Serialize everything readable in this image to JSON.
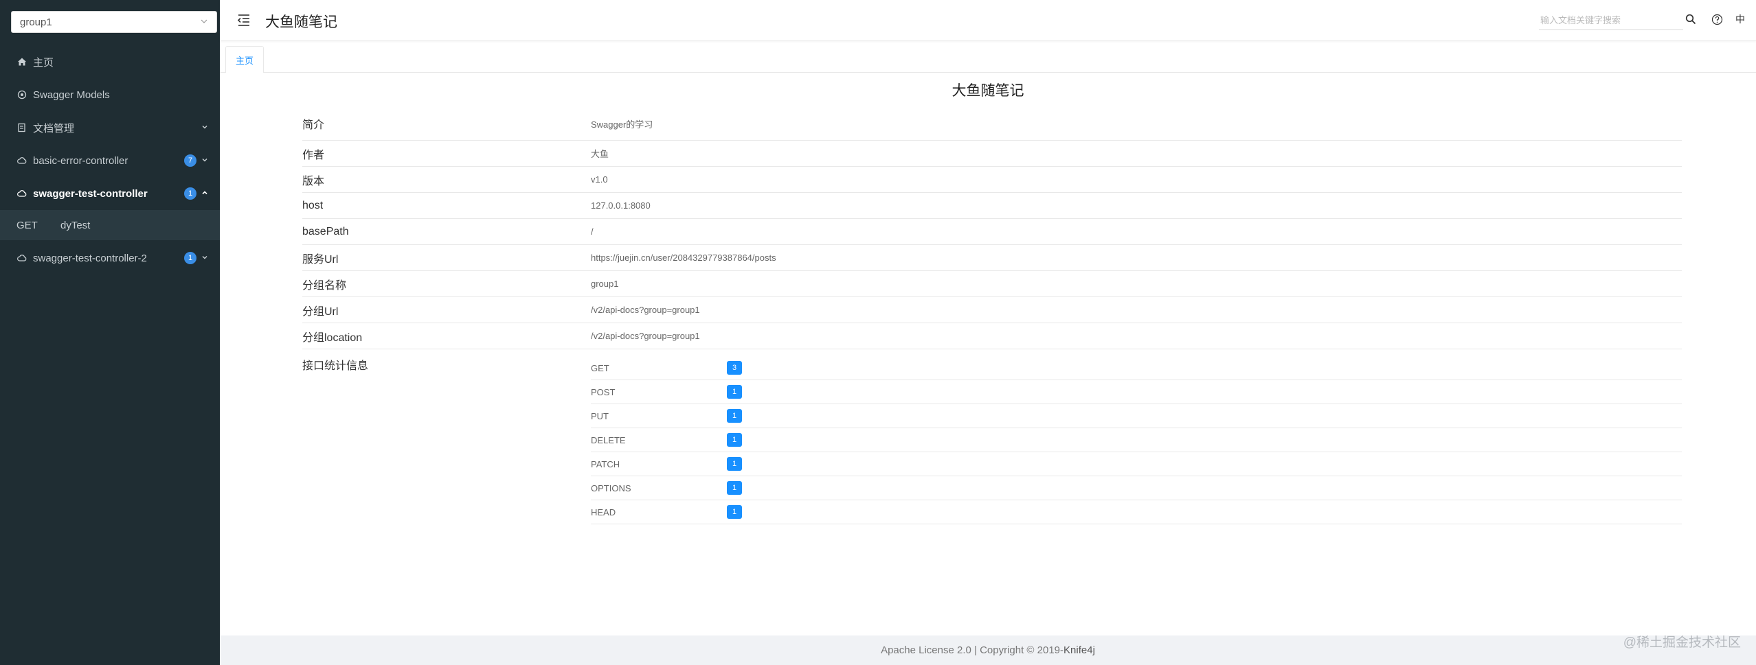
{
  "sidebar": {
    "group_value": "group1",
    "items": [
      {
        "label": "主页",
        "icon": "home-icon"
      },
      {
        "label": "Swagger Models",
        "icon": "models-icon"
      },
      {
        "label": "文档管理",
        "icon": "doc-icon"
      },
      {
        "label": "basic-error-controller",
        "icon": "cloud-icon",
        "count": "7"
      },
      {
        "label": "swagger-test-controller",
        "icon": "cloud-icon",
        "count": "1"
      },
      {
        "label": "swagger-test-controller-2",
        "icon": "cloud-icon",
        "count": "1"
      }
    ],
    "submenu": {
      "method": "GET",
      "label": "dyTest"
    }
  },
  "header": {
    "title": "大鱼随笔记",
    "search_placeholder": "输入文档关键字搜索",
    "lang": "中"
  },
  "tabs": [
    {
      "label": "主页"
    }
  ],
  "doc": {
    "title": "大鱼随笔记",
    "rows": [
      {
        "key": "简介",
        "value": "Swagger的学习"
      },
      {
        "key": "作者",
        "value": "大鱼"
      },
      {
        "key": "版本",
        "value": "v1.0"
      },
      {
        "key": "host",
        "value": "127.0.0.1:8080"
      },
      {
        "key": "basePath",
        "value": "/"
      },
      {
        "key": "服务Url",
        "value": "https://juejin.cn/user/2084329779387864/posts"
      },
      {
        "key": "分组名称",
        "value": "group1"
      },
      {
        "key": "分组Url",
        "value": "/v2/api-docs?group=group1"
      },
      {
        "key": "分组location",
        "value": "/v2/api-docs?group=group1"
      }
    ],
    "stats_label": "接口统计信息",
    "stats": [
      {
        "method": "GET",
        "count": "3"
      },
      {
        "method": "POST",
        "count": "1"
      },
      {
        "method": "PUT",
        "count": "1"
      },
      {
        "method": "DELETE",
        "count": "1"
      },
      {
        "method": "PATCH",
        "count": "1"
      },
      {
        "method": "OPTIONS",
        "count": "1"
      },
      {
        "method": "HEAD",
        "count": "1"
      }
    ]
  },
  "footer": {
    "text": "Apache License 2.0 | Copyright © 2019-",
    "brand": "Knife4j"
  },
  "watermark": "@稀土掘金技术社区",
  "colors": {
    "sidebar_bg": "#1f2d33",
    "accent": "#1890ff",
    "count_badge": "#3a8ee6"
  }
}
